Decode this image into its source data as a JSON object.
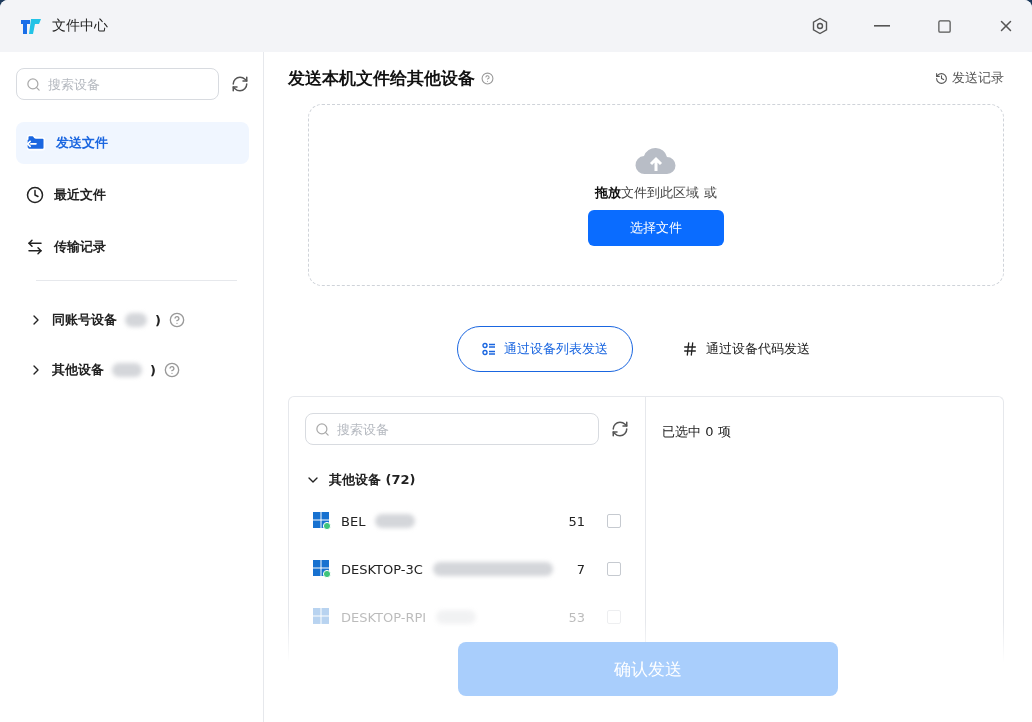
{
  "window": {
    "title": "文件中心"
  },
  "sidebar": {
    "search": {
      "placeholder": "搜索设备"
    },
    "nav": [
      {
        "kind": "send",
        "label": "发送文件",
        "selected": true
      },
      {
        "kind": "recent",
        "label": "最近文件",
        "selected": false
      },
      {
        "kind": "transfer",
        "label": "传输记录",
        "selected": false
      }
    ],
    "groups": [
      {
        "label": "同账号设备",
        "suffix": ")",
        "expanded": false
      },
      {
        "label": "其他设备",
        "suffix": ")",
        "expanded": false
      }
    ]
  },
  "main": {
    "title": "发送本机文件给其他设备",
    "history_link": "发送记录",
    "dropzone": {
      "text_bold": "拖放",
      "text": "文件到此区域 或",
      "button": "选择文件"
    },
    "tabs": [
      {
        "kind": "list",
        "label": "通过设备列表发送",
        "selected": true
      },
      {
        "kind": "code",
        "label": "通过设备代码发送",
        "selected": false
      }
    ],
    "device_search": {
      "placeholder": "搜索设备"
    },
    "device_group": {
      "label": "其他设备 (72)",
      "expanded": true
    },
    "devices": [
      {
        "name": "BEL",
        "code": "51",
        "online": true,
        "checked": false,
        "faded": false
      },
      {
        "name": "DESKTOP-3C",
        "code": "7",
        "online": true,
        "checked": false,
        "faded": false
      },
      {
        "name": "DESKTOP-RPI",
        "code": "53",
        "online": false,
        "checked": false,
        "faded": true
      }
    ],
    "selected_count": "已选中 0 项",
    "confirm": {
      "label": "确认发送",
      "disabled": true
    }
  }
}
